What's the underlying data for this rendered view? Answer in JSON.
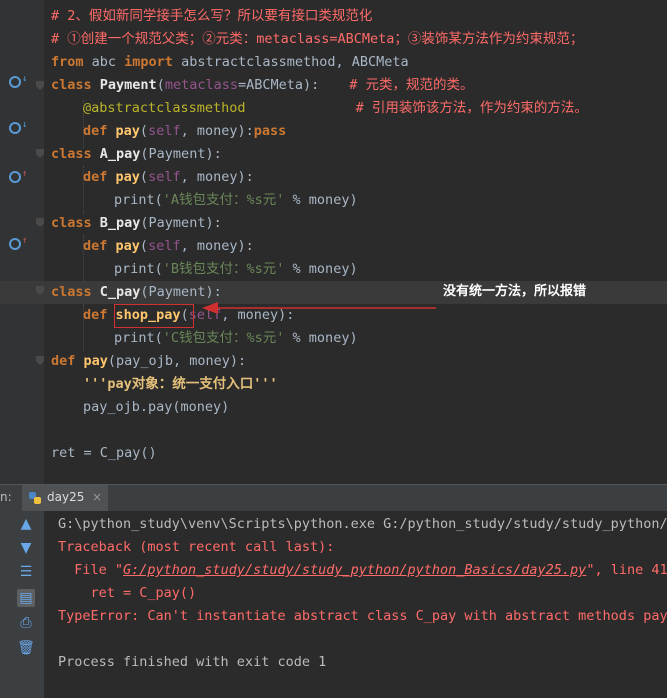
{
  "editor": {
    "comment1": "# 2、假如新同学接手怎么写？所以要有接口类规范化",
    "comment2": "# ①创建一个规范父类；②元类：metaclass=ABCMeta；③装饰某方法作为约束规范；",
    "import_from": "from",
    "import_module": " abc ",
    "import_kw": "import",
    "import_names": " abstractclassmethod, ABCMeta",
    "class_kw": "class",
    "payment_name": "Payment",
    "paren_open": "(",
    "metaclass_kw": "metaclass",
    "metaclass_eq": "=",
    "metaclass_val": "ABCMeta",
    "paren_close_colon": "):",
    "comment_meta": "# 元类，规范的类。",
    "decorator": "@abstractclassmethod",
    "comment_deco": "# 引用装饰该方法，作为约束的方法。",
    "def_kw": "def",
    "pay_name": "pay",
    "self_kw": "self",
    "args_money": ", money)",
    "colon": ":",
    "pass_kw": "pass",
    "a_pay_name": "A_pay",
    "b_pay_name": "B_pay",
    "c_pay_name": "C_pay",
    "parent_payment": "(Payment):",
    "print_fn": "print",
    "str_a": "'A钱包支付：%s元'",
    "str_b": "'B钱包支付：%s元'",
    "str_c": "'C钱包支付：%s元'",
    "percent_money": " % money)",
    "shop_pay_name": "shop_pay",
    "pay_sig": "(pay_ojb, money):",
    "docstring": "'''pay对象：统一支付入口'''",
    "pay_call": "pay_ojb.pay(money)",
    "ret_line": "ret = C_pay()",
    "annotation": "没有统一方法，所以报错"
  },
  "run": {
    "label_prefix": "n:",
    "tab_name": "day25",
    "tab_close": "×",
    "cmd": "G:\\python_study\\venv\\Scripts\\python.exe G:/python_study/study/study_python/p",
    "traceback": "Traceback (most recent call last):",
    "file_prefix": "  File \"",
    "file_link": "G:/python_study/study/study_python/python_Basics/day25.py",
    "file_suffix": "\", line 41,",
    "code_line": "    ret = C_pay()",
    "type_error": "TypeError: Can't instantiate abstract class C_pay with abstract methods pay",
    "finished": "Process finished with exit code 1"
  },
  "icons": {
    "run_up": "arrow-up-icon",
    "run_down": "arrow-down-icon",
    "soft_wrap": "soft-wrap-icon",
    "scroll_end": "scroll-to-end-icon",
    "print": "print-icon",
    "trash": "trash-icon"
  }
}
